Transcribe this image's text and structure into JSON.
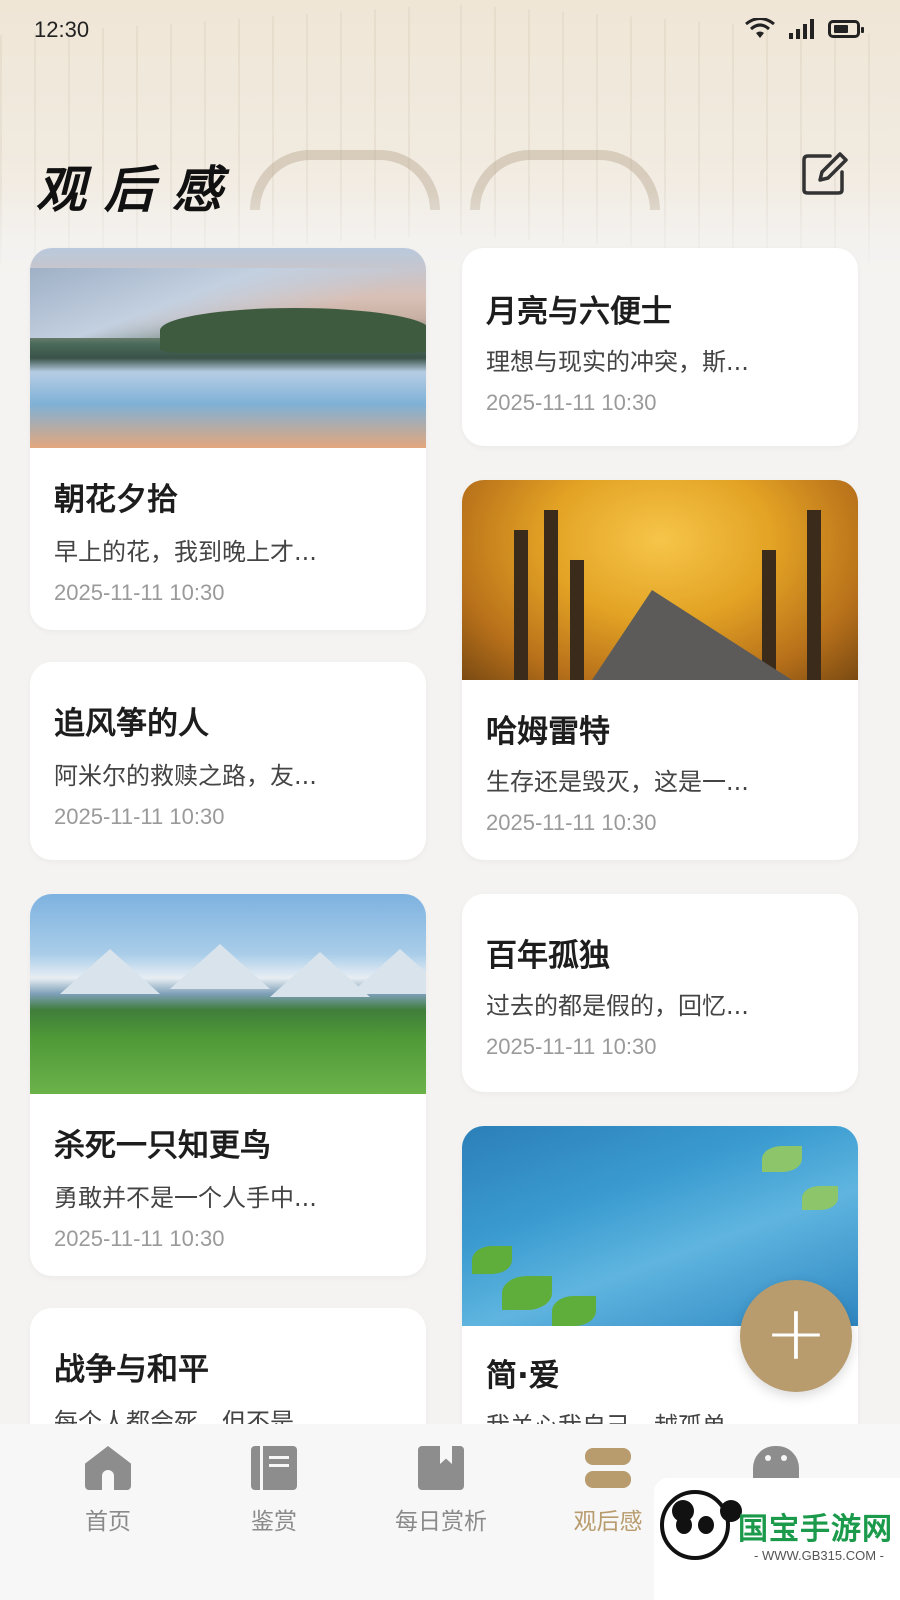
{
  "status_bar": {
    "time": "12:30"
  },
  "header": {
    "title": "观后感",
    "edit_icon": "edit-icon"
  },
  "cards_left": [
    {
      "title": "朝花夕拾",
      "excerpt": "早上的花，我到晚上才...",
      "date": "2025-11-11 10:30",
      "image": "lake-mountain"
    },
    {
      "title": "追风筝的人",
      "excerpt": "阿米尔的救赎之路，友...",
      "date": "2025-11-11 10:30"
    },
    {
      "title": "杀死一只知更鸟",
      "excerpt": "勇敢并不是一个人手中...",
      "date": "2025-11-11 10:30",
      "image": "green-meadow"
    },
    {
      "title": "战争与和平",
      "excerpt": "每个人都会死，但不是..."
    }
  ],
  "cards_right": [
    {
      "title": "月亮与六便士",
      "excerpt": "理想与现实的冲突，斯...",
      "date": "2025-11-11 10:30"
    },
    {
      "title": "哈姆雷特",
      "excerpt": "生存还是毁灭，这是一...",
      "date": "2025-11-11 10:30",
      "image": "autumn-road"
    },
    {
      "title": "百年孤独",
      "excerpt": "过去的都是假的，回忆...",
      "date": "2025-11-11 10:30"
    },
    {
      "title": "简·爱",
      "excerpt": "我关心我自己，越孤单...",
      "image": "blue-water"
    }
  ],
  "fab": {
    "label": "+"
  },
  "bottom_nav": [
    {
      "label": "首页",
      "icon": "home-icon"
    },
    {
      "label": "鉴赏",
      "icon": "book-icon"
    },
    {
      "label": "每日赏析",
      "icon": "bookmark-icon"
    },
    {
      "label": "观后感",
      "icon": "stack-icon",
      "active": true
    },
    {
      "label": "",
      "icon": "chat-icon"
    }
  ],
  "watermark": {
    "brand": "国宝手游网",
    "url": "- WWW.GB315.COM -"
  },
  "colors": {
    "accent": "#b89c6e",
    "background": "#f4f3f1",
    "card": "#ffffff",
    "muted": "#9a9a9a"
  }
}
